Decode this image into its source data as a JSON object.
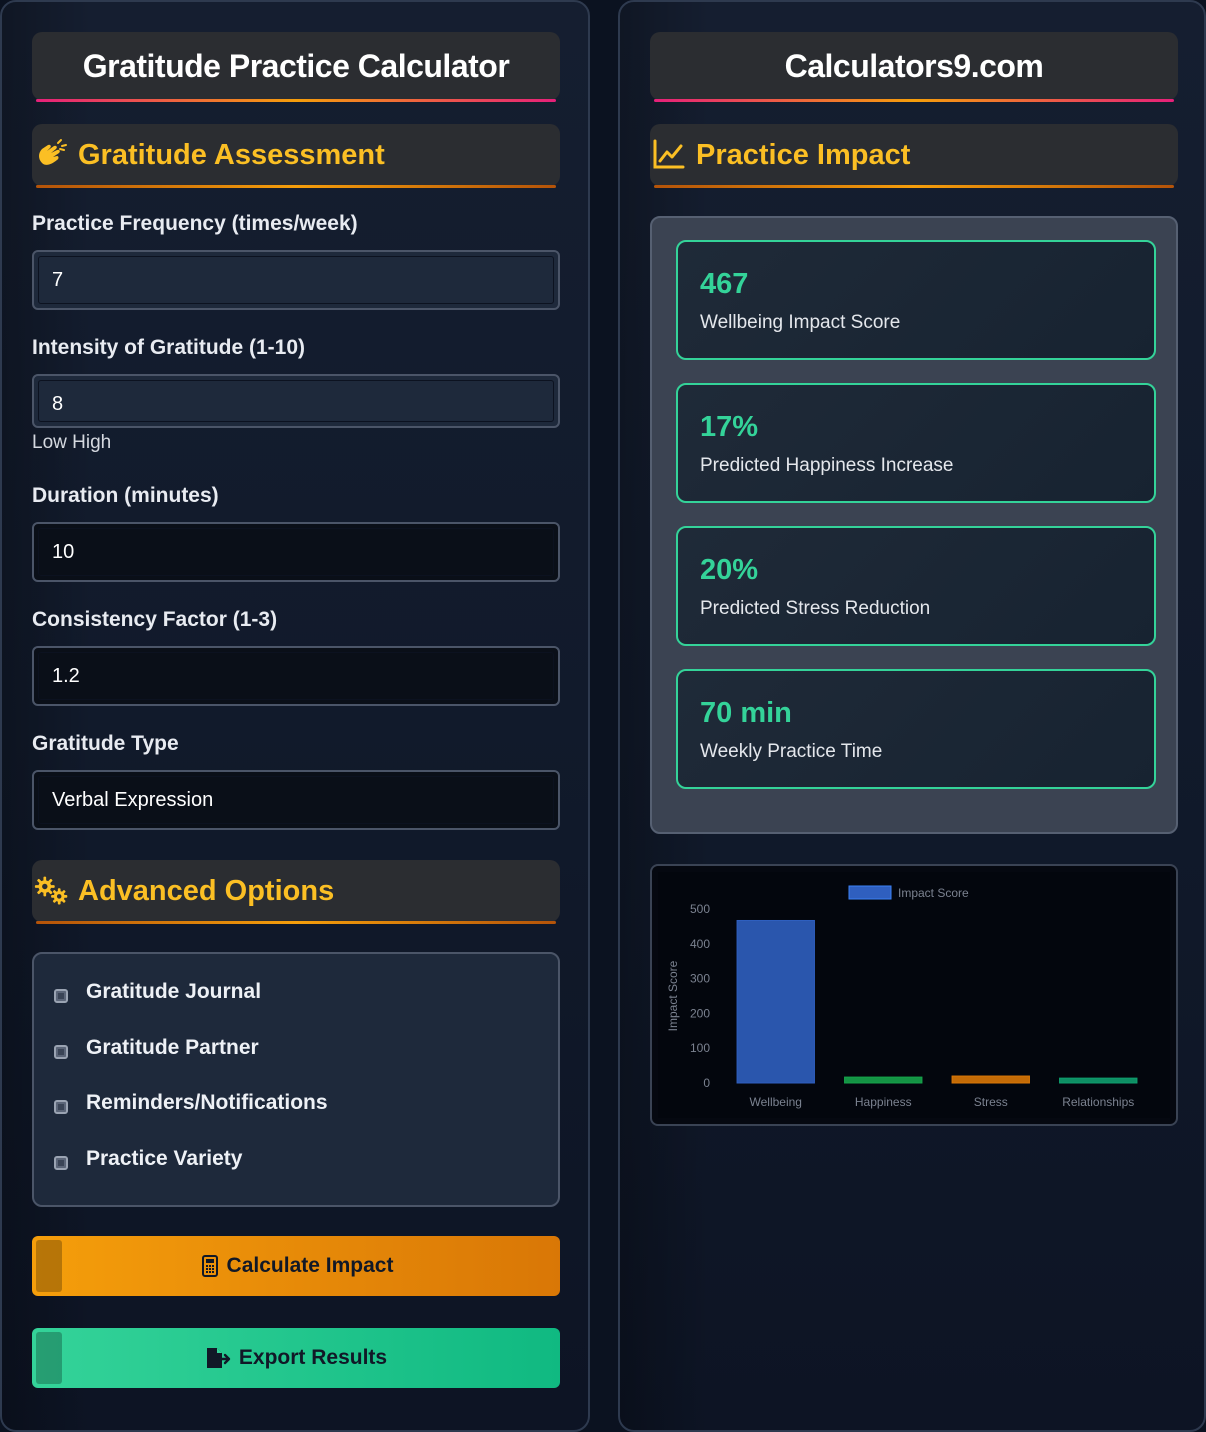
{
  "left": {
    "title": "Gratitude Practice Calculator",
    "assessment": {
      "heading": "Gratitude Assessment",
      "icon": "clapping-hands-icon",
      "frequency": {
        "label": "Practice Frequency (times/week)",
        "value": "7"
      },
      "intensity": {
        "label": "Intensity of Gratitude (1-10)",
        "value": "8",
        "hint": "Low High"
      },
      "duration": {
        "label": "Duration (minutes)",
        "value": "10"
      },
      "consistency": {
        "label": "Consistency Factor (1-3)",
        "value": "1.2"
      },
      "type": {
        "label": "Gratitude Type",
        "value": "Verbal Expression"
      }
    },
    "advanced": {
      "heading": "Advanced Options",
      "icon": "gears-icon",
      "options": [
        {
          "label": "Gratitude Journal"
        },
        {
          "label": "Gratitude Partner"
        },
        {
          "label": "Reminders/Notifications"
        },
        {
          "label": "Practice Variety"
        }
      ]
    },
    "buttons": {
      "calculate": "Calculate Impact",
      "export": "Export Results"
    },
    "colors": {
      "accent": "#fbbf24",
      "orange": "#f59e0b",
      "green": "#10b981"
    }
  },
  "right": {
    "title": "Calculators9.com",
    "impact": {
      "heading": "Practice Impact",
      "icon": "line-chart-icon",
      "cards": [
        {
          "value": "467",
          "label": "Wellbeing Impact Score"
        },
        {
          "value": "17%",
          "label": "Predicted Happiness Increase"
        },
        {
          "value": "20%",
          "label": "Predicted Stress Reduction"
        },
        {
          "value": "70 min",
          "label": "Weekly Practice Time"
        }
      ]
    }
  },
  "chart_data": {
    "type": "bar",
    "categories": [
      "Wellbeing",
      "Happiness",
      "Stress",
      "Relationships"
    ],
    "series": [
      {
        "name": "Impact Score",
        "values": [
          467,
          17,
          20,
          14
        ],
        "colors": [
          "#2f5fbf",
          "#16a34a",
          "#d97706",
          "#0f9f6e"
        ]
      }
    ],
    "ylabel": "Impact Score",
    "ylim": [
      0,
      500
    ],
    "yticks": [
      "0",
      "100",
      "200",
      "300",
      "400",
      "500"
    ],
    "legend": "top-center",
    "grid": false
  }
}
